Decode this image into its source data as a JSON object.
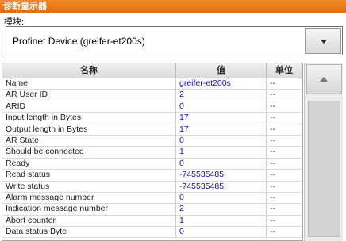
{
  "window": {
    "title": "诊断显示器"
  },
  "module": {
    "label": "模块:",
    "selected": "Profinet Device (greifer-et200s)"
  },
  "table": {
    "headers": {
      "name": "名称",
      "value": "值",
      "unit": "单位"
    },
    "rows": [
      {
        "name": "Name",
        "value": "greifer-et200s",
        "unit": "--"
      },
      {
        "name": "AR User ID",
        "value": "2",
        "unit": "--"
      },
      {
        "name": "ARID",
        "value": "0",
        "unit": "--"
      },
      {
        "name": "Input length in Bytes",
        "value": "17",
        "unit": "--"
      },
      {
        "name": "Output length in Bytes",
        "value": "17",
        "unit": "--"
      },
      {
        "name": "AR State",
        "value": "0",
        "unit": "--"
      },
      {
        "name": "Should be connected",
        "value": "1",
        "unit": "--"
      },
      {
        "name": "Ready",
        "value": "0",
        "unit": "--"
      },
      {
        "name": "Read status",
        "value": "-745535485",
        "unit": "--"
      },
      {
        "name": "Write status",
        "value": "-745535485",
        "unit": "--"
      },
      {
        "name": "Alarm message number",
        "value": "0",
        "unit": "--"
      },
      {
        "name": "Indication message number",
        "value": "2",
        "unit": "--"
      },
      {
        "name": "Abort counter",
        "value": "1",
        "unit": "--"
      },
      {
        "name": "Data status Byte",
        "value": "0",
        "unit": "--"
      }
    ]
  },
  "colors": {
    "titlebar": "#e8801c",
    "value_text": "#1111cc"
  }
}
